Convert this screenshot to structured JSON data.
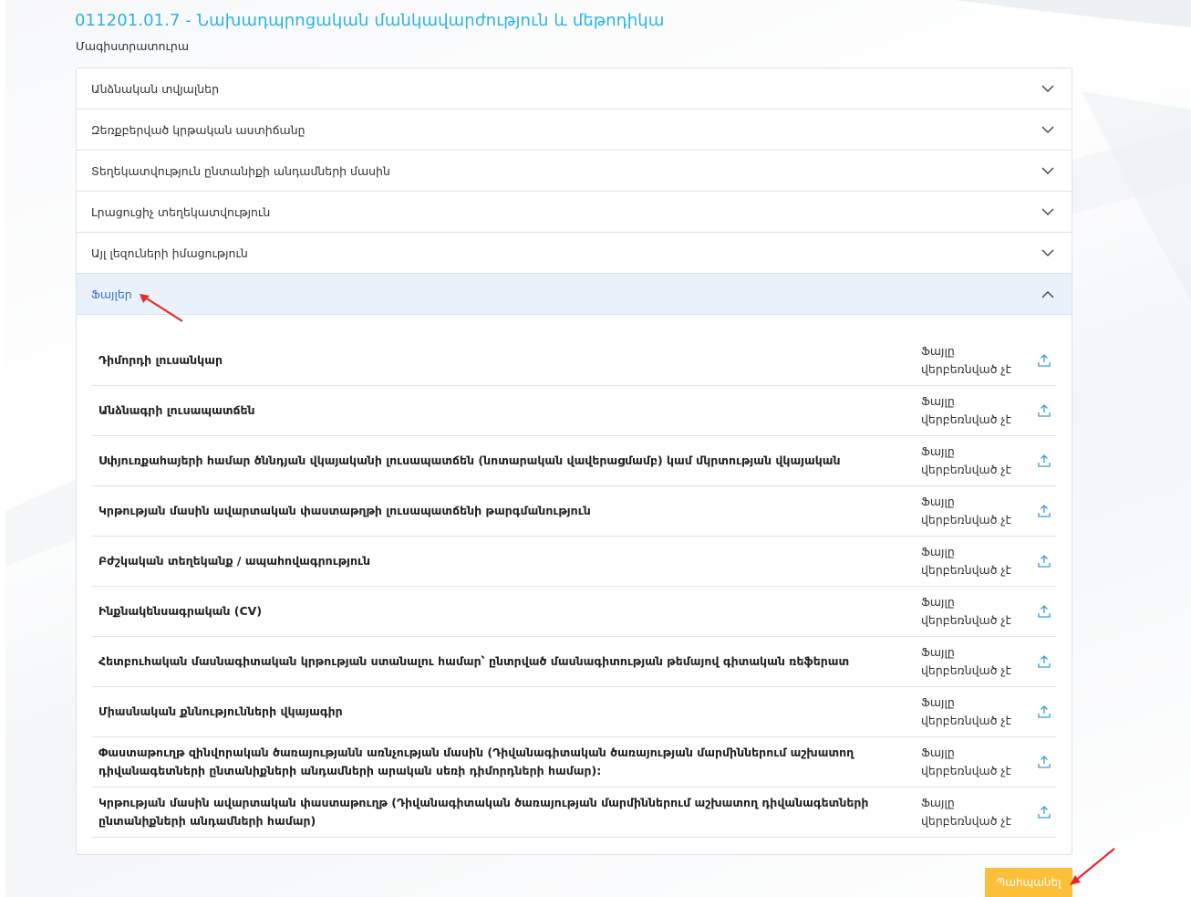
{
  "header": {
    "title": "011201.01.7 - Նախադպրոցական մանկավարժություն և մեթոդիկա",
    "subtitle": "Մագիստրատուրա"
  },
  "sections": [
    {
      "label": "Անձնական տվյալներ",
      "expanded": false
    },
    {
      "label": "Զեռքբերված կրթական աստիճանը",
      "expanded": false
    },
    {
      "label": "Տեղեկատվություն ընտանիքի անդամների մասին",
      "expanded": false
    },
    {
      "label": "Լրացուցիչ տեղեկատվություն",
      "expanded": false
    },
    {
      "label": "Այլ լեզուների իմացություն",
      "expanded": false
    },
    {
      "label": "Ֆայլեր",
      "expanded": true
    }
  ],
  "files": [
    {
      "name": "Դիմորդի լուսանկար",
      "status_line1": "Ֆայլը",
      "status_line2": "վերբեռնված չէ"
    },
    {
      "name": "Անձնագրի լուսապատճեն",
      "status_line1": "Ֆայլը",
      "status_line2": "վերբեռնված չէ"
    },
    {
      "name": "Սփյուռքահայերի համար ծննդյան վկայականի լուսապատճեն (նոտարական վավերացմամբ) կամ մկրտության վկայական",
      "status_line1": "Ֆայլը",
      "status_line2": "վերբեռնված չէ"
    },
    {
      "name": "Կրթության մասին ավարտական փաստաթղթի լուսապատճենի թարգմանություն",
      "status_line1": "Ֆայլը",
      "status_line2": "վերբեռնված չէ"
    },
    {
      "name": "Բժշկական տեղեկանք / ապահովագրություն",
      "status_line1": "Ֆայլը",
      "status_line2": "վերբեռնված չէ"
    },
    {
      "name": "Ինքնակենսագրական (CV)",
      "status_line1": "Ֆայլը",
      "status_line2": "վերբեռնված չէ"
    },
    {
      "name": "Հետբուհական մասնագիտական կրթության ստանալու համար՝ ընտրված մասնագիտության թեմայով գիտական ռեֆերատ",
      "status_line1": "Ֆայլը",
      "status_line2": "վերբեռնված չէ"
    },
    {
      "name": "Միասնական քննությունների վկայագիր",
      "status_line1": "Ֆայլը",
      "status_line2": "վերբեռնված չէ"
    },
    {
      "name": "Փաստաթուղթ զինվորական ծառայությանն առնչության մասին (Դիվանագիտական ծառայության մարմիններում աշխատող դիվանագետների ընտանիքների անդամների արական սեռի դիմորդների համար):",
      "status_line1": "Ֆայլը",
      "status_line2": "վերբեռնված չէ"
    },
    {
      "name": "Կրթության մասին ավարտական փաստաթուղթ (Դիվանագիտական ծառայության մարմիններում աշխատող դիվանագետների ընտանիքների անդամների համար)",
      "status_line1": "Ֆայլը",
      "status_line2": "վերբեռնված չէ"
    }
  ],
  "save_label": "Պահպանել",
  "colors": {
    "accent_title": "#2cb3e6",
    "active_section_bg": "#e9f1fb",
    "active_section_text": "#3d6fc9",
    "save_button": "#fbbf3a",
    "annotation_arrow": "#e32b2b"
  },
  "icons": {
    "collapsed": "chevron-down-icon",
    "expanded": "chevron-up-icon",
    "upload": "upload-icon"
  }
}
